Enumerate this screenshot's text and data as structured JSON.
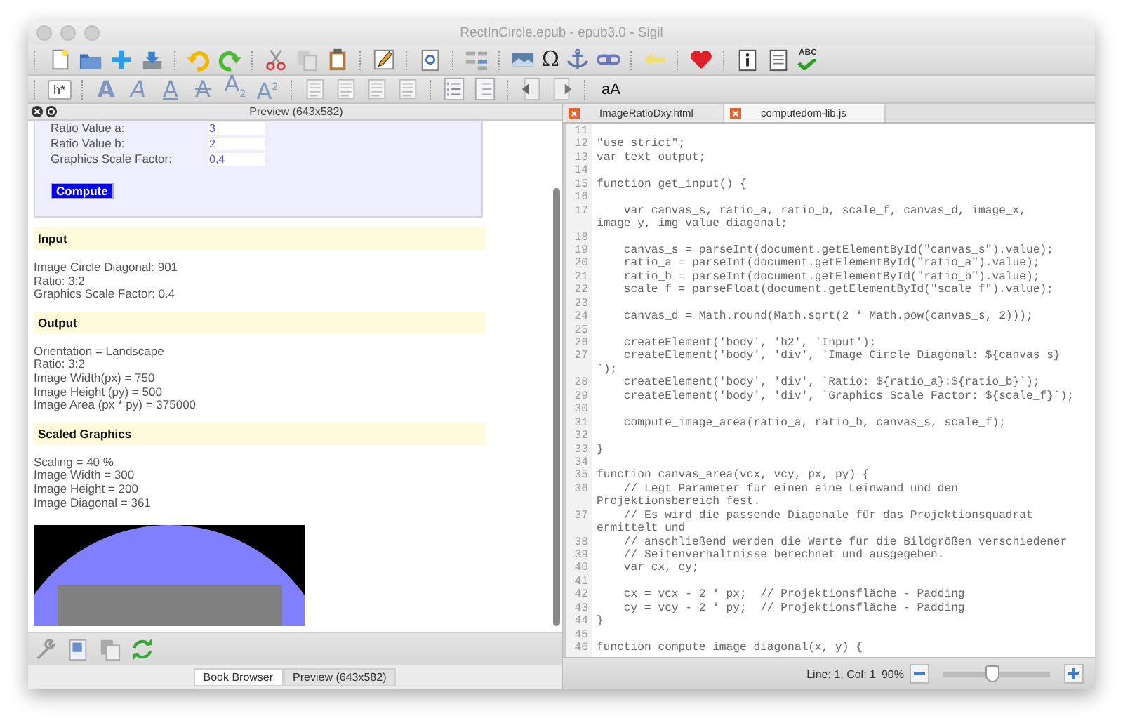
{
  "window": {
    "title": "RectInCircle.epub - epub3.0 - Sigil"
  },
  "toolbar": {
    "symbol": "Ω",
    "spellcheck": "ABC"
  },
  "format_toolbar": {
    "heading": "h*",
    "styles": [
      {
        "kind": "bold",
        "label": "A"
      },
      {
        "kind": "italic",
        "label": "A"
      },
      {
        "kind": "underline",
        "label": "A"
      },
      {
        "kind": "strike",
        "label": "A"
      },
      {
        "kind": "sub",
        "label": "A$_{2}$"
      },
      {
        "kind": "sup",
        "label": "A$^{2}$"
      }
    ],
    "case": "aA"
  },
  "preview": {
    "title": "Preview (643x582)",
    "form": [
      {
        "label": "Ratio Value a:",
        "value": "3"
      },
      {
        "label": "Ratio Value b:",
        "value": "2"
      },
      {
        "label": "Graphics Scale Factor:",
        "value": "0,4"
      }
    ],
    "button": "Compute",
    "sections": [
      {
        "heading": "Input",
        "lines": [
          "Image Circle Diagonal: 901",
          "Ratio: 3:2",
          "Graphics Scale Factor: 0.4"
        ]
      },
      {
        "heading": "Output",
        "lines": [
          "Orientation = Landscape",
          "Ratio: 3:2",
          "Image Width(px) = 750",
          "Image Height (py) = 500",
          "Image Area (px * py) = 375000"
        ]
      },
      {
        "heading": "Scaled Graphics",
        "lines": [
          "Scaling = 40 %",
          "Image Width = 300",
          "Image Height = 200",
          "Image Diagonal = 361"
        ]
      }
    ]
  },
  "bottom_tabs": [
    {
      "label": "Book Browser",
      "selected": true
    },
    {
      "label": "Preview (643x582)",
      "selected": false
    }
  ],
  "editor_tabs": [
    {
      "label": "ImageRatioDxy.html",
      "selected": false
    },
    {
      "label": "computedom-lib.js",
      "selected": true
    }
  ],
  "code": [
    {
      "number": "11"
    },
    {
      "number": "12",
      "text": "\"use strict\";"
    },
    {
      "number": "13",
      "text": "var text_output;"
    },
    {
      "number": "14"
    },
    {
      "number": "15",
      "text": "function get_input() {"
    },
    {
      "number": "16"
    },
    {
      "number": "17",
      "text": "    var canvas_s, ratio_a, ratio_b, scale_f, canvas_d, image_x,",
      "wrap": "image_y, img_value_diagonal;"
    },
    {
      "number": "18"
    },
    {
      "number": "19",
      "text": "    canvas_s = parseInt(document.getElementById(\"canvas_s\").value);"
    },
    {
      "number": "20",
      "text": "    ratio_a = parseInt(document.getElementById(\"ratio_a\").value);"
    },
    {
      "number": "21",
      "text": "    ratio_b = parseInt(document.getElementById(\"ratio_b\").value);"
    },
    {
      "number": "22",
      "text": "    scale_f = parseFloat(document.getElementById(\"scale_f\").value);"
    },
    {
      "number": "23"
    },
    {
      "number": "24",
      "text": "    canvas_d = Math.round(Math.sqrt(2 * Math.pow(canvas_s, 2)));"
    },
    {
      "number": "25"
    },
    {
      "number": "26",
      "text": "    createElement('body', 'h2', 'Input');"
    },
    {
      "number": "27",
      "text": "    createElement('body', 'div', `Image Circle Diagonal: ${canvas_s}",
      "wrap": "`);"
    },
    {
      "number": "28",
      "text": "    createElement('body', 'div', `Ratio: ${ratio_a}:${ratio_b}`);"
    },
    {
      "number": "29",
      "text": "    createElement('body', 'div', `Graphics Scale Factor: ${scale_f}`);"
    },
    {
      "number": "30"
    },
    {
      "number": "31",
      "text": "    compute_image_area(ratio_a, ratio_b, canvas_s, scale_f);"
    },
    {
      "number": "32"
    },
    {
      "number": "33",
      "text": "}"
    },
    {
      "number": "34"
    },
    {
      "number": "35",
      "text": "function canvas_area(vcx, vcy, px, py) {"
    },
    {
      "number": "36",
      "text": "    // Legt Parameter für einen eine Leinwand und den",
      "wrap": "Projektionsbereich fest."
    },
    {
      "number": "37",
      "text": "    // Es wird die passende Diagonale für das Projektionsquadrat",
      "wrap": "ermittelt und"
    },
    {
      "number": "38",
      "text": "    // anschließend werden die Werte für die Bildgrößen verschiedener"
    },
    {
      "number": "39",
      "text": "    // Seitenverhältnisse berechnet und ausgegeben."
    },
    {
      "number": "40",
      "text": "    var cx, cy;"
    },
    {
      "number": "41"
    },
    {
      "number": "42",
      "text": "    cx = vcx - 2 * px;  // Projektionsfläche - Padding"
    },
    {
      "number": "43",
      "text": "    cy = vcy - 2 * py;  // Projektionsfläche - Padding"
    },
    {
      "number": "44",
      "text": "}"
    },
    {
      "number": "45"
    },
    {
      "number": "46",
      "text": "function compute_image_diagonal(x, y) {"
    }
  ],
  "status_bar": {
    "position": "Line: 1, Col: 1",
    "zoom": "90%",
    "zoom_slider": {
      "level": 0.45
    }
  }
}
